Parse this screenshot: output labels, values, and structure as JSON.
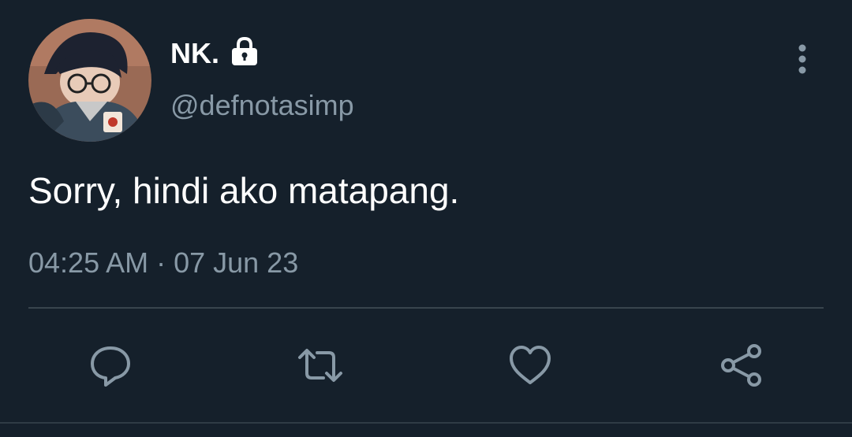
{
  "user": {
    "display_name": "NK.",
    "handle": "@defnotasimp",
    "protected": true,
    "avatar_alt": "profile picture"
  },
  "tweet": {
    "text": "Sorry, hindi ako matapang.",
    "timestamp": "04:25 AM · 07 Jun 23"
  },
  "actions": [
    {
      "name": "reply",
      "icon": "speech-bubble-icon"
    },
    {
      "name": "retweet",
      "icon": "retweet-icon"
    },
    {
      "name": "like",
      "icon": "heart-icon"
    },
    {
      "name": "share",
      "icon": "share-icon"
    }
  ],
  "colors": {
    "background": "#15202b",
    "primary_text": "#ffffff",
    "secondary_text": "#8899a6",
    "icon": "#8899a6",
    "divider": "#38444d"
  }
}
